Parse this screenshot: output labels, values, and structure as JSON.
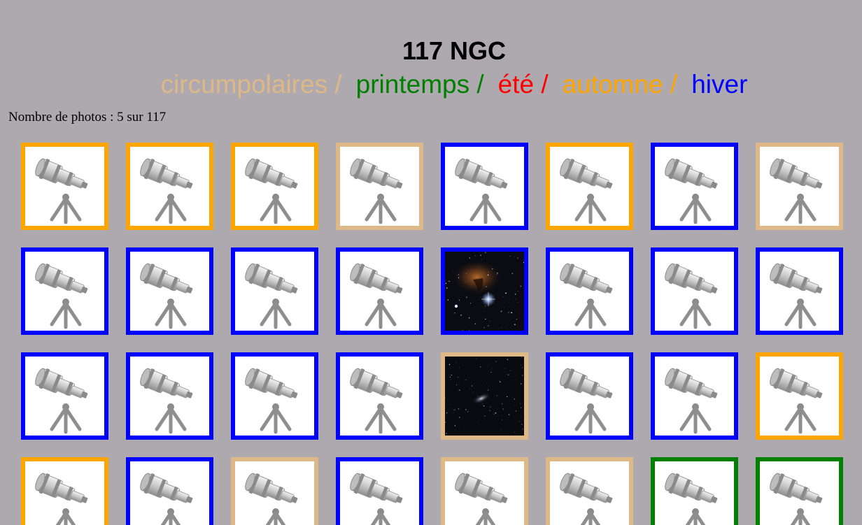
{
  "header": {
    "title": "117 NGC",
    "seasons": [
      {
        "label": "circumpolaires",
        "color": "#deb887",
        "sep": " /"
      },
      {
        "label": "printemps",
        "color": "#008000",
        "sep": " /"
      },
      {
        "label": "été",
        "color": "#ff0000",
        "sep": " /"
      },
      {
        "label": "automne",
        "color": "#ffa500",
        "sep": " /"
      },
      {
        "label": "hiver",
        "color": "#0000ff",
        "sep": ""
      }
    ]
  },
  "count_text": "Nombre de photos : 5 sur 117",
  "season_colors": {
    "circumpolaires": "#deb887",
    "printemps": "#008000",
    "ete": "#ff0000",
    "automne": "#ffa500",
    "hiver": "#0000ff"
  },
  "tiles": [
    {
      "season": "automne",
      "type": "telescope-icon"
    },
    {
      "season": "automne",
      "type": "telescope-icon"
    },
    {
      "season": "automne",
      "type": "telescope-icon"
    },
    {
      "season": "circumpolaires",
      "type": "telescope-icon"
    },
    {
      "season": "hiver",
      "type": "telescope-icon"
    },
    {
      "season": "automne",
      "type": "telescope-icon"
    },
    {
      "season": "hiver",
      "type": "telescope-icon"
    },
    {
      "season": "circumpolaires",
      "type": "telescope-icon"
    },
    {
      "season": "hiver",
      "type": "telescope-icon"
    },
    {
      "season": "hiver",
      "type": "telescope-icon"
    },
    {
      "season": "hiver",
      "type": "telescope-icon"
    },
    {
      "season": "hiver",
      "type": "telescope-icon"
    },
    {
      "season": "hiver",
      "type": "nebula-photo"
    },
    {
      "season": "hiver",
      "type": "telescope-icon"
    },
    {
      "season": "hiver",
      "type": "telescope-icon"
    },
    {
      "season": "hiver",
      "type": "telescope-icon"
    },
    {
      "season": "hiver",
      "type": "telescope-icon"
    },
    {
      "season": "hiver",
      "type": "telescope-icon"
    },
    {
      "season": "hiver",
      "type": "telescope-icon"
    },
    {
      "season": "hiver",
      "type": "telescope-icon"
    },
    {
      "season": "circumpolaires",
      "type": "galaxy-photo"
    },
    {
      "season": "hiver",
      "type": "telescope-icon"
    },
    {
      "season": "hiver",
      "type": "telescope-icon"
    },
    {
      "season": "automne",
      "type": "telescope-icon"
    },
    {
      "season": "automne",
      "type": "telescope-icon"
    },
    {
      "season": "hiver",
      "type": "telescope-icon"
    },
    {
      "season": "circumpolaires",
      "type": "telescope-icon"
    },
    {
      "season": "hiver",
      "type": "telescope-icon"
    },
    {
      "season": "circumpolaires",
      "type": "telescope-icon"
    },
    {
      "season": "circumpolaires",
      "type": "telescope-icon"
    },
    {
      "season": "printemps",
      "type": "telescope-icon"
    },
    {
      "season": "printemps",
      "type": "telescope-icon"
    }
  ]
}
